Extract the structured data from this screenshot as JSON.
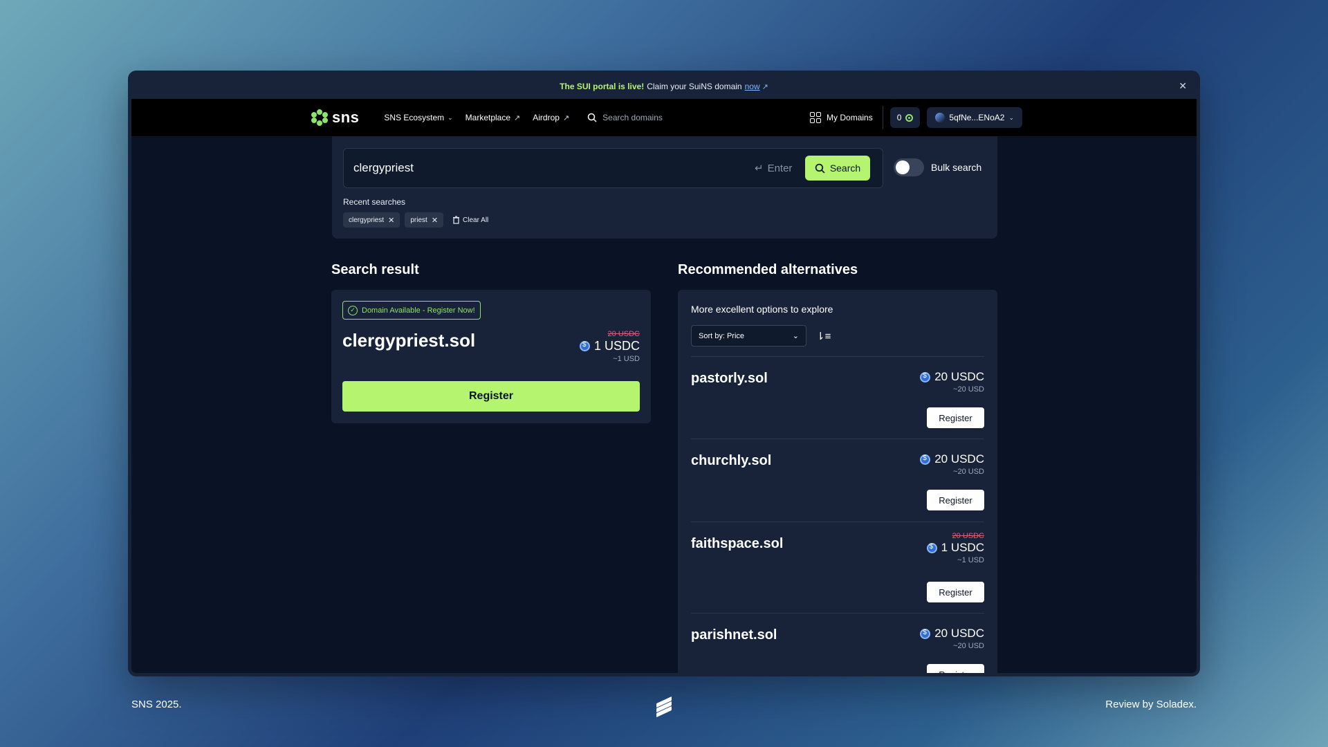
{
  "banner": {
    "highlight": "The SUI portal is live!",
    "text": "Claim your SuiNS domain",
    "link": "now",
    "close_icon": "close-icon"
  },
  "nav": {
    "logo_text": "sns",
    "items": [
      {
        "label": "SNS Ecosystem",
        "icon": "chevron-down-icon"
      },
      {
        "label": "Marketplace",
        "icon": "external-link-icon"
      },
      {
        "label": "Airdrop",
        "icon": "external-link-icon"
      }
    ],
    "search_placeholder": "Search domains",
    "my_domains": "My Domains",
    "balance": "0",
    "wallet": "5qfNe...ENoA2"
  },
  "search": {
    "value": "clergypriest",
    "enter_hint": "Enter",
    "button": "Search",
    "bulk_label": "Bulk search",
    "bulk_enabled": false,
    "recent_title": "Recent searches",
    "recent": [
      "clergypriest",
      "priest"
    ],
    "clear_all": "Clear All"
  },
  "result": {
    "section_title": "Search result",
    "badge": "Domain Available - Register Now!",
    "name": "clergypriest.sol",
    "old_price": "20 USDC",
    "price": "1 USDC",
    "usd": "~1 USD",
    "register": "Register"
  },
  "alternatives": {
    "section_title": "Recommended alternatives",
    "subtitle": "More excellent options to explore",
    "sort_label": "Sort by: Price",
    "items": [
      {
        "name": "pastorly.sol",
        "old_price": "",
        "price": "20 USDC",
        "usd": "~20 USD",
        "register": "Register"
      },
      {
        "name": "churchly.sol",
        "old_price": "",
        "price": "20 USDC",
        "usd": "~20 USD",
        "register": "Register"
      },
      {
        "name": "faithspace.sol",
        "old_price": "20 USDC",
        "price": "1 USDC",
        "usd": "~1 USD",
        "register": "Register"
      },
      {
        "name": "parishnet.sol",
        "old_price": "",
        "price": "20 USDC",
        "usd": "~20 USD",
        "register": "Register"
      }
    ]
  },
  "footer": {
    "left": "SNS 2025.",
    "right": "Review by Soladex."
  },
  "colors": {
    "accent": "#b5f46f",
    "background": "#0a1325",
    "panel": "#18233a",
    "strike": "#e85c7a"
  }
}
